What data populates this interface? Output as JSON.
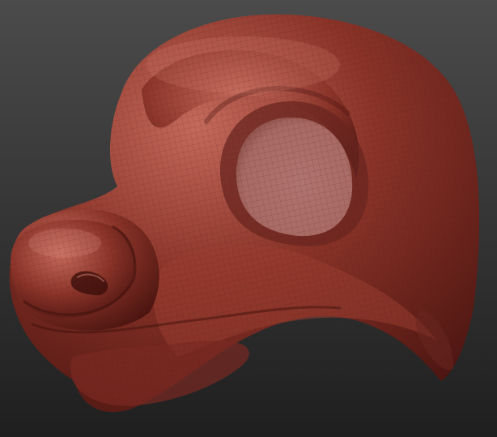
{
  "scene": {
    "subject": "head-sculpt",
    "colors": {
      "background_top": "#4b4b4b",
      "background_bottom": "#1f1f1f",
      "clay_base": "#8a3328",
      "clay_highlight": "#c46a5c",
      "clay_shadow": "#4a1410",
      "eye_socket": "#a86a64",
      "wire": "#5a1e18"
    }
  }
}
